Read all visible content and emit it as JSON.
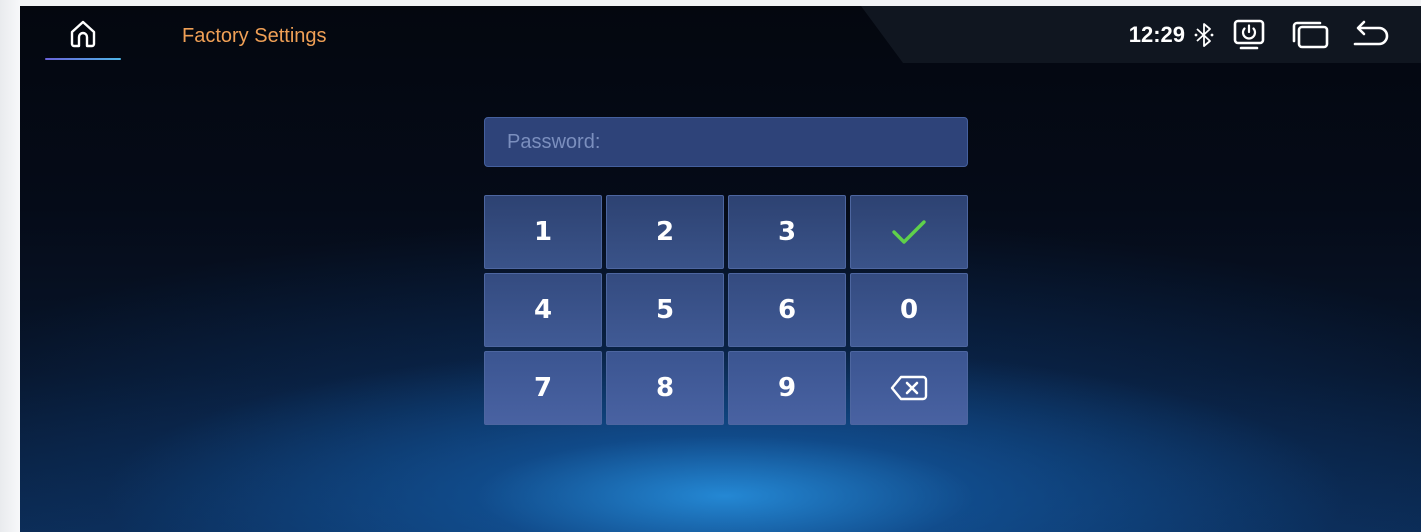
{
  "header": {
    "title": "Factory Settings",
    "home_icon": "home-icon",
    "accent_color": "#f0a056"
  },
  "status": {
    "time": "12:29",
    "icons": [
      "bluetooth-icon",
      "screen-power-icon",
      "window-icon",
      "back-icon"
    ]
  },
  "password": {
    "placeholder": "Password:",
    "value": ""
  },
  "keypad": {
    "keys": [
      {
        "label": "1",
        "type": "digit"
      },
      {
        "label": "2",
        "type": "digit"
      },
      {
        "label": "3",
        "type": "digit"
      },
      {
        "label": "",
        "type": "confirm",
        "icon": "check-icon",
        "color": "#5fd14a"
      },
      {
        "label": "4",
        "type": "digit"
      },
      {
        "label": "5",
        "type": "digit"
      },
      {
        "label": "6",
        "type": "digit"
      },
      {
        "label": "0",
        "type": "digit"
      },
      {
        "label": "7",
        "type": "digit"
      },
      {
        "label": "8",
        "type": "digit"
      },
      {
        "label": "9",
        "type": "digit"
      },
      {
        "label": "",
        "type": "backspace",
        "icon": "backspace-icon"
      }
    ]
  }
}
